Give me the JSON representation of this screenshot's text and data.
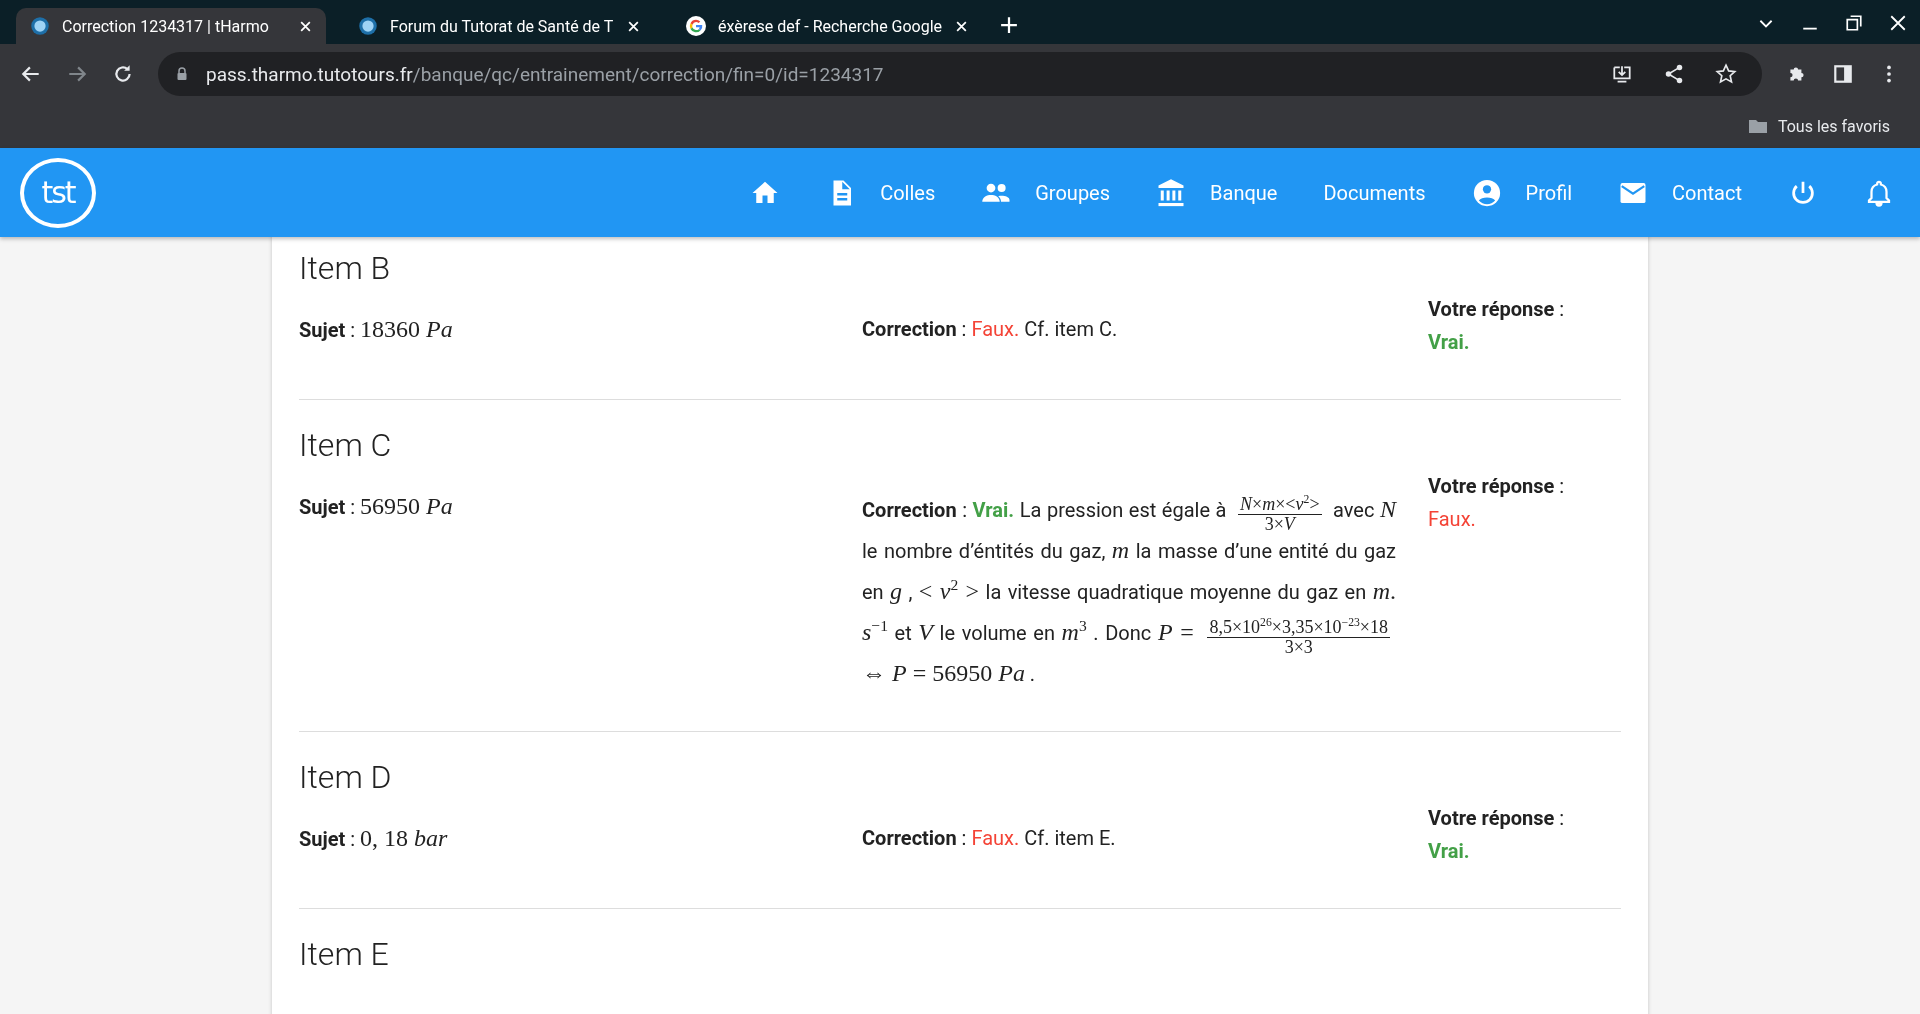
{
  "browser": {
    "tabs": [
      {
        "title": "Correction 1234317 | tHarmo",
        "kind": "site",
        "selected": true
      },
      {
        "title": "Forum du Tutorat de Santé de T",
        "kind": "site",
        "selected": false
      },
      {
        "title": "éxèrese def - Recherche Google",
        "kind": "google",
        "selected": false
      }
    ],
    "url_host": "pass.tharmo.tutotours.fr",
    "url_path": "/banque/qc/entrainement/correction/fin=0/id=1234317",
    "bookmarks_folder": "Tous les favoris"
  },
  "site": {
    "logo": "tst",
    "nav": [
      {
        "kind": "home"
      },
      {
        "kind": "doc",
        "label": "Colles"
      },
      {
        "kind": "group",
        "label": "Groupes"
      },
      {
        "kind": "bank",
        "label": "Banque"
      },
      {
        "kind": "text",
        "label": "Documents"
      },
      {
        "kind": "profile",
        "label": "Profil"
      },
      {
        "kind": "mail",
        "label": "Contact"
      },
      {
        "kind": "power"
      },
      {
        "kind": "bell"
      }
    ]
  },
  "items": [
    {
      "title": "Item B",
      "subject_label": "**Sujet** :",
      "subject": "18360 *Pa*",
      "correction_label": "**Correction** :",
      "verdict": {
        "text": "Faux.",
        "correct": false
      },
      "correction": [
        {
          "kind": "text",
          "text": " Cf. item C."
        }
      ],
      "answer_label": "**Votre réponse** :",
      "answer": {
        "text": "Vrai.",
        "correct": true
      }
    },
    {
      "title": "Item C",
      "subject_label": "**Sujet** :",
      "subject": "56950 *Pa*",
      "correction_label": "**Correction** :",
      "verdict": {
        "text": "Vrai.",
        "correct": true
      },
      "correction": [
        {
          "kind": "text",
          "text": " La pression est égale à "
        },
        {
          "kind": "frac",
          "num": "*N*×*m*×<*v*$^{2}$>",
          "den": "3×*V*"
        },
        {
          "kind": "text",
          "text": " avec "
        },
        {
          "kind": "math",
          "text": "*N*"
        },
        {
          "kind": "text",
          "text": " le nombre d’éntités du gaz, "
        },
        {
          "kind": "math",
          "text": "*m*"
        },
        {
          "kind": "text",
          "text": " la masse d’une entité du gaz en "
        },
        {
          "kind": "math",
          "text": "*g*"
        },
        {
          "kind": "text",
          "text": " , "
        },
        {
          "kind": "math",
          "text": "< *v*$^{2}$ >"
        },
        {
          "kind": "text",
          "text": " la vitesse quadratique moyenne du gaz en "
        },
        {
          "kind": "math",
          "text": "*m*. *s*$^{−1}$"
        },
        {
          "kind": "text",
          "text": " et "
        },
        {
          "kind": "math",
          "text": "*V*"
        },
        {
          "kind": "text",
          "text": " le volume en "
        },
        {
          "kind": "math",
          "text": "*m*$^{3}$"
        },
        {
          "kind": "text",
          "text": " . Donc "
        },
        {
          "kind": "math",
          "text": "*P* = "
        },
        {
          "kind": "frac",
          "num": "8,5×10$^{26}$×3,35×10$^{−23}$×18",
          "den": "3×3"
        },
        {
          "kind": "math",
          "text": " ⇔ *P* = 56950 *Pa*"
        },
        {
          "kind": "text",
          "text": " ."
        }
      ],
      "answer_label": "**Votre réponse** :",
      "answer": {
        "text": "Faux.",
        "correct": false
      }
    },
    {
      "title": "Item D",
      "subject_label": "**Sujet** :",
      "subject": "0, 18 *bar*",
      "correction_label": "**Correction** :",
      "verdict": {
        "text": "Faux.",
        "correct": false
      },
      "correction": [
        {
          "kind": "text",
          "text": " Cf. item E."
        }
      ],
      "answer_label": "**Votre réponse** :",
      "answer": {
        "text": "Vrai.",
        "correct": true
      }
    },
    {
      "title": "Item E"
    }
  ]
}
